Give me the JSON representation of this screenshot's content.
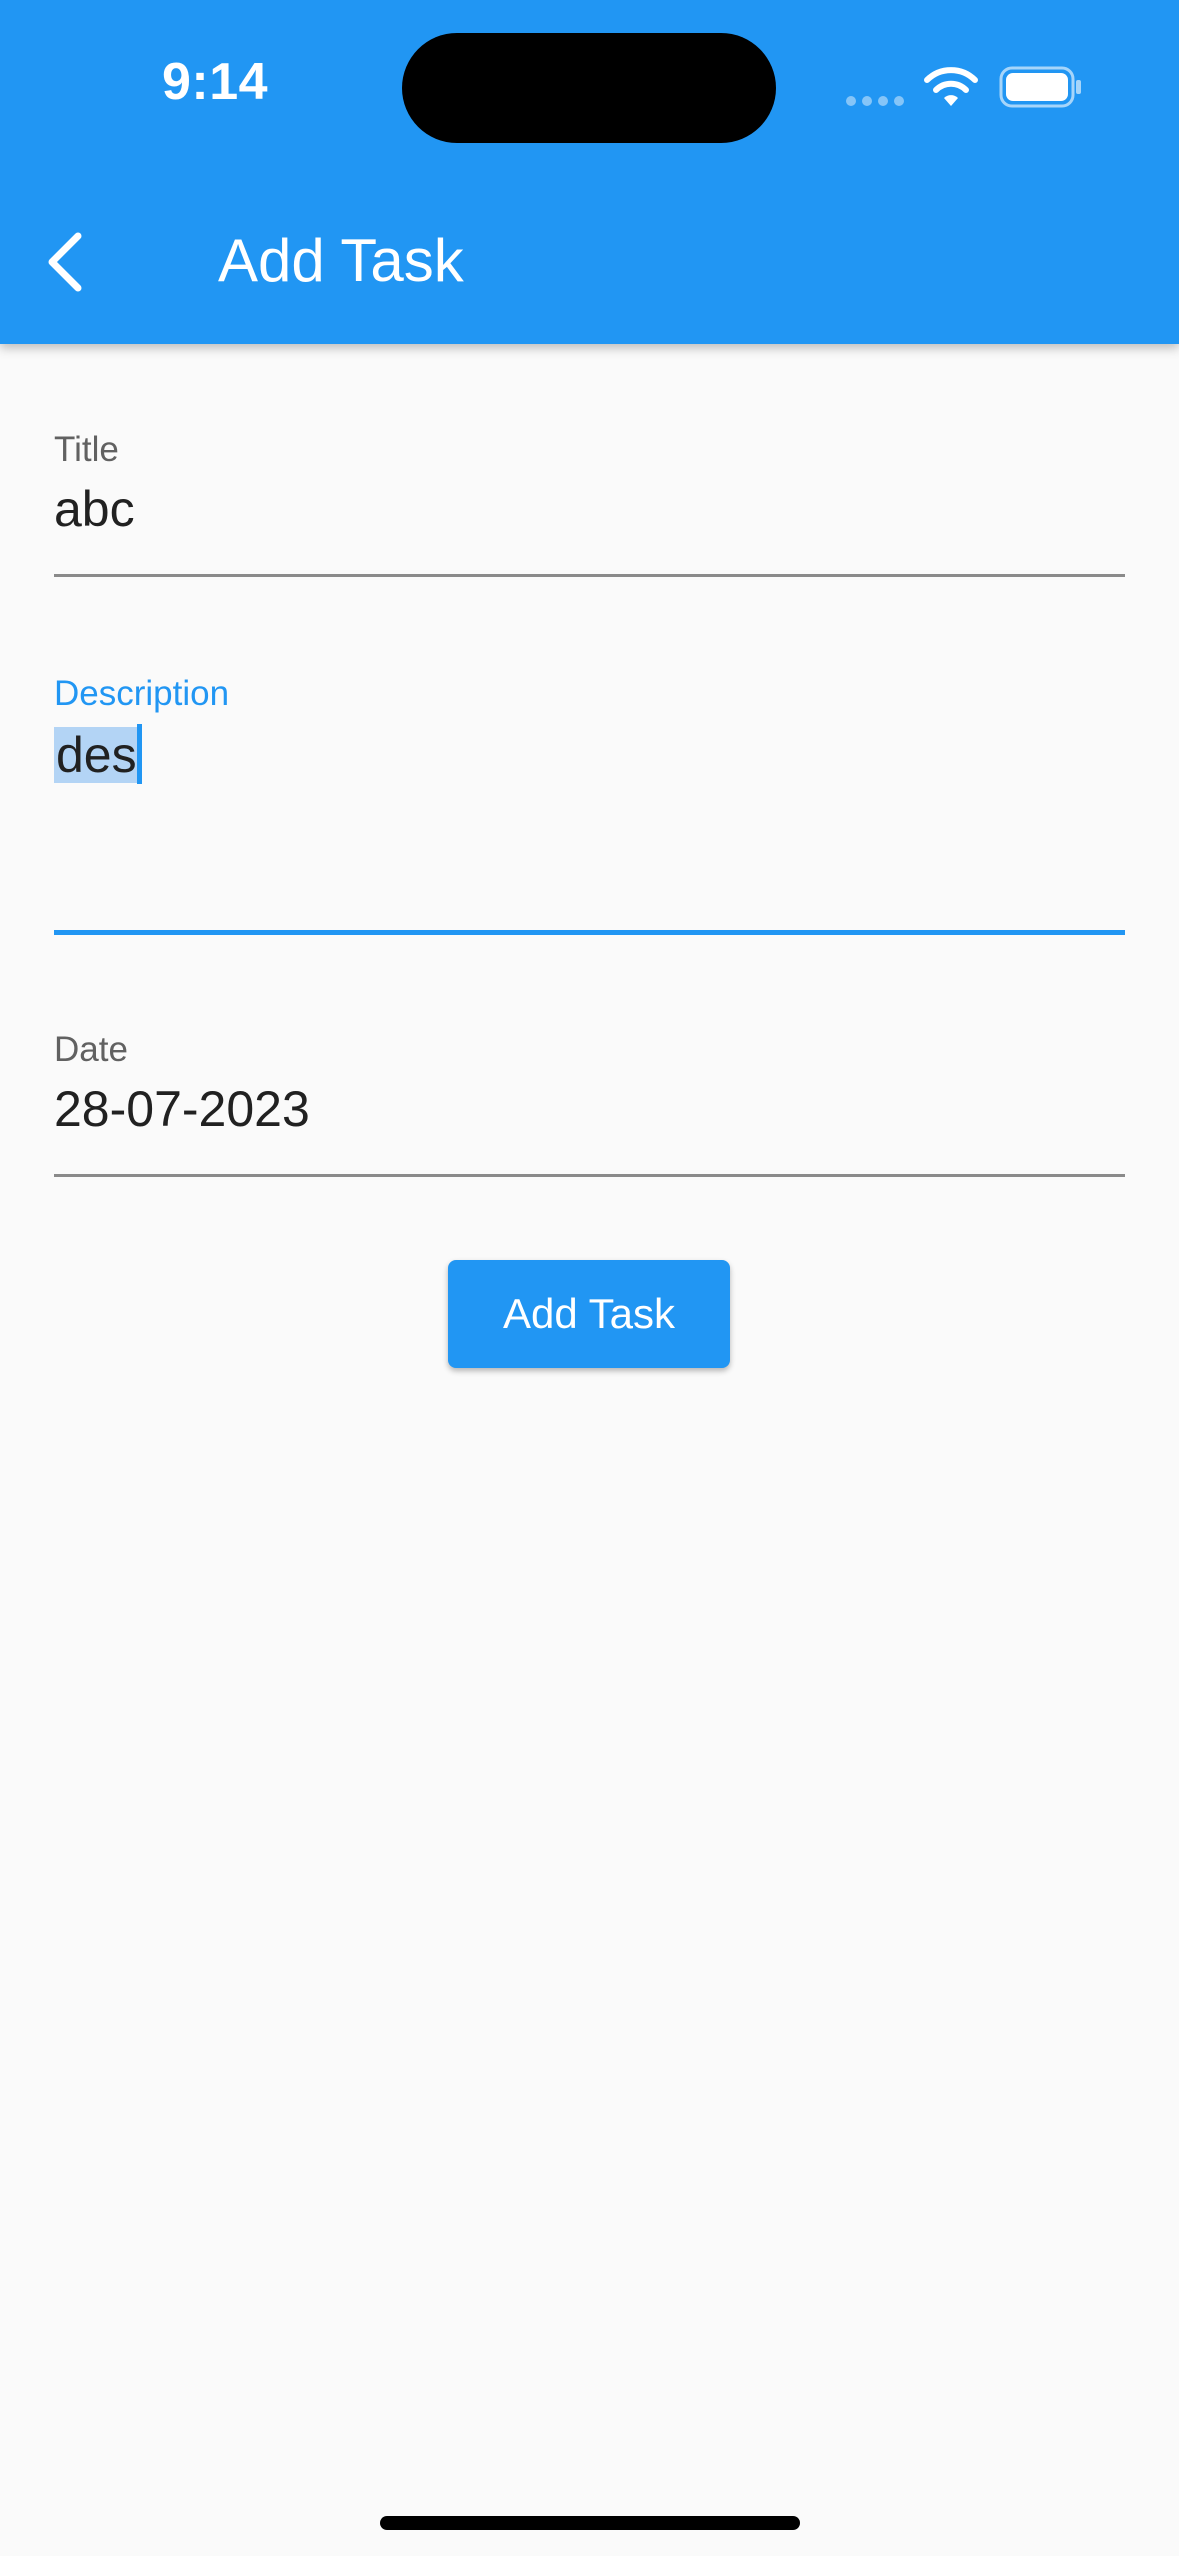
{
  "status_bar": {
    "time": "9:14",
    "icons": [
      "signal-dots-icon",
      "wifi-icon",
      "battery-icon"
    ]
  },
  "app_bar": {
    "title": "Add Task",
    "back_icon": "chevron-left-icon",
    "background_color": "#2196f3"
  },
  "form": {
    "title": {
      "label": "Title",
      "value": "abc"
    },
    "description": {
      "label": "Description",
      "value": "des",
      "focused": true,
      "text_selected": true
    },
    "date": {
      "label": "Date",
      "value": "28-07-2023"
    }
  },
  "actions": {
    "add_task_label": "Add Task"
  },
  "colors": {
    "accent": "#2196f3",
    "background": "#fafafa",
    "selection": "#b3d4f5"
  }
}
